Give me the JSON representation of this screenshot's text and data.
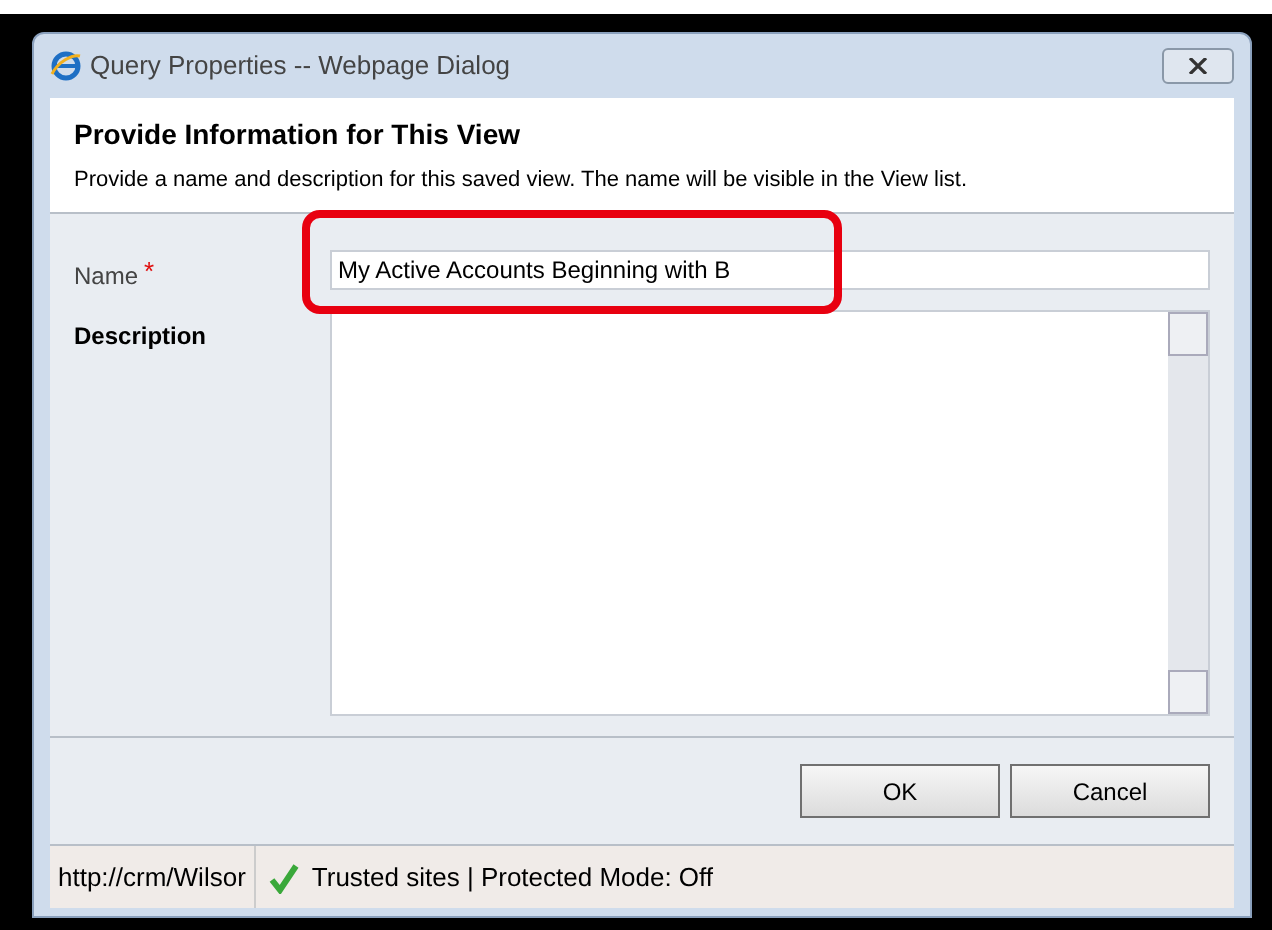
{
  "window": {
    "title": "Query Properties -- Webpage Dialog"
  },
  "header": {
    "title": "Provide Information for This View",
    "subtitle": "Provide a name and description for this saved view. The name will be visible in the View list."
  },
  "fields": [
    {
      "label": "Name",
      "required": true,
      "required_mark": "*",
      "value": "My Active Accounts Beginning with B",
      "kind": "text",
      "highlighted": true
    },
    {
      "label": "Description",
      "required": false,
      "kind": "textarea",
      "highlighted": false
    }
  ],
  "buttons": [
    "OK",
    "Cancel"
  ],
  "status_bar": {
    "url": "http://crm/Wilsor",
    "zone": "Trusted sites | Protected Mode: Off"
  }
}
